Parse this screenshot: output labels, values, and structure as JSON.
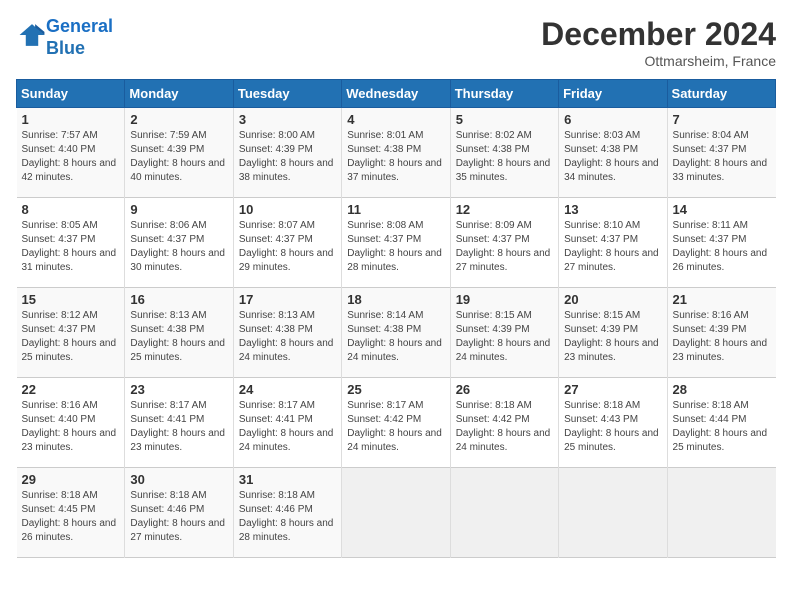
{
  "header": {
    "logo_line1": "General",
    "logo_line2": "Blue",
    "month_title": "December 2024",
    "location": "Ottmarsheim, France"
  },
  "days_of_week": [
    "Sunday",
    "Monday",
    "Tuesday",
    "Wednesday",
    "Thursday",
    "Friday",
    "Saturday"
  ],
  "weeks": [
    [
      {
        "day": "1",
        "sunrise": "7:57 AM",
        "sunset": "4:40 PM",
        "daylight": "8 hours and 42 minutes."
      },
      {
        "day": "2",
        "sunrise": "7:59 AM",
        "sunset": "4:39 PM",
        "daylight": "8 hours and 40 minutes."
      },
      {
        "day": "3",
        "sunrise": "8:00 AM",
        "sunset": "4:39 PM",
        "daylight": "8 hours and 38 minutes."
      },
      {
        "day": "4",
        "sunrise": "8:01 AM",
        "sunset": "4:38 PM",
        "daylight": "8 hours and 37 minutes."
      },
      {
        "day": "5",
        "sunrise": "8:02 AM",
        "sunset": "4:38 PM",
        "daylight": "8 hours and 35 minutes."
      },
      {
        "day": "6",
        "sunrise": "8:03 AM",
        "sunset": "4:38 PM",
        "daylight": "8 hours and 34 minutes."
      },
      {
        "day": "7",
        "sunrise": "8:04 AM",
        "sunset": "4:37 PM",
        "daylight": "8 hours and 33 minutes."
      }
    ],
    [
      {
        "day": "8",
        "sunrise": "8:05 AM",
        "sunset": "4:37 PM",
        "daylight": "8 hours and 31 minutes."
      },
      {
        "day": "9",
        "sunrise": "8:06 AM",
        "sunset": "4:37 PM",
        "daylight": "8 hours and 30 minutes."
      },
      {
        "day": "10",
        "sunrise": "8:07 AM",
        "sunset": "4:37 PM",
        "daylight": "8 hours and 29 minutes."
      },
      {
        "day": "11",
        "sunrise": "8:08 AM",
        "sunset": "4:37 PM",
        "daylight": "8 hours and 28 minutes."
      },
      {
        "day": "12",
        "sunrise": "8:09 AM",
        "sunset": "4:37 PM",
        "daylight": "8 hours and 27 minutes."
      },
      {
        "day": "13",
        "sunrise": "8:10 AM",
        "sunset": "4:37 PM",
        "daylight": "8 hours and 27 minutes."
      },
      {
        "day": "14",
        "sunrise": "8:11 AM",
        "sunset": "4:37 PM",
        "daylight": "8 hours and 26 minutes."
      }
    ],
    [
      {
        "day": "15",
        "sunrise": "8:12 AM",
        "sunset": "4:37 PM",
        "daylight": "8 hours and 25 minutes."
      },
      {
        "day": "16",
        "sunrise": "8:13 AM",
        "sunset": "4:38 PM",
        "daylight": "8 hours and 25 minutes."
      },
      {
        "day": "17",
        "sunrise": "8:13 AM",
        "sunset": "4:38 PM",
        "daylight": "8 hours and 24 minutes."
      },
      {
        "day": "18",
        "sunrise": "8:14 AM",
        "sunset": "4:38 PM",
        "daylight": "8 hours and 24 minutes."
      },
      {
        "day": "19",
        "sunrise": "8:15 AM",
        "sunset": "4:39 PM",
        "daylight": "8 hours and 24 minutes."
      },
      {
        "day": "20",
        "sunrise": "8:15 AM",
        "sunset": "4:39 PM",
        "daylight": "8 hours and 23 minutes."
      },
      {
        "day": "21",
        "sunrise": "8:16 AM",
        "sunset": "4:39 PM",
        "daylight": "8 hours and 23 minutes."
      }
    ],
    [
      {
        "day": "22",
        "sunrise": "8:16 AM",
        "sunset": "4:40 PM",
        "daylight": "8 hours and 23 minutes."
      },
      {
        "day": "23",
        "sunrise": "8:17 AM",
        "sunset": "4:41 PM",
        "daylight": "8 hours and 23 minutes."
      },
      {
        "day": "24",
        "sunrise": "8:17 AM",
        "sunset": "4:41 PM",
        "daylight": "8 hours and 24 minutes."
      },
      {
        "day": "25",
        "sunrise": "8:17 AM",
        "sunset": "4:42 PM",
        "daylight": "8 hours and 24 minutes."
      },
      {
        "day": "26",
        "sunrise": "8:18 AM",
        "sunset": "4:42 PM",
        "daylight": "8 hours and 24 minutes."
      },
      {
        "day": "27",
        "sunrise": "8:18 AM",
        "sunset": "4:43 PM",
        "daylight": "8 hours and 25 minutes."
      },
      {
        "day": "28",
        "sunrise": "8:18 AM",
        "sunset": "4:44 PM",
        "daylight": "8 hours and 25 minutes."
      }
    ],
    [
      {
        "day": "29",
        "sunrise": "8:18 AM",
        "sunset": "4:45 PM",
        "daylight": "8 hours and 26 minutes."
      },
      {
        "day": "30",
        "sunrise": "8:18 AM",
        "sunset": "4:46 PM",
        "daylight": "8 hours and 27 minutes."
      },
      {
        "day": "31",
        "sunrise": "8:18 AM",
        "sunset": "4:46 PM",
        "daylight": "8 hours and 28 minutes."
      },
      null,
      null,
      null,
      null
    ]
  ]
}
